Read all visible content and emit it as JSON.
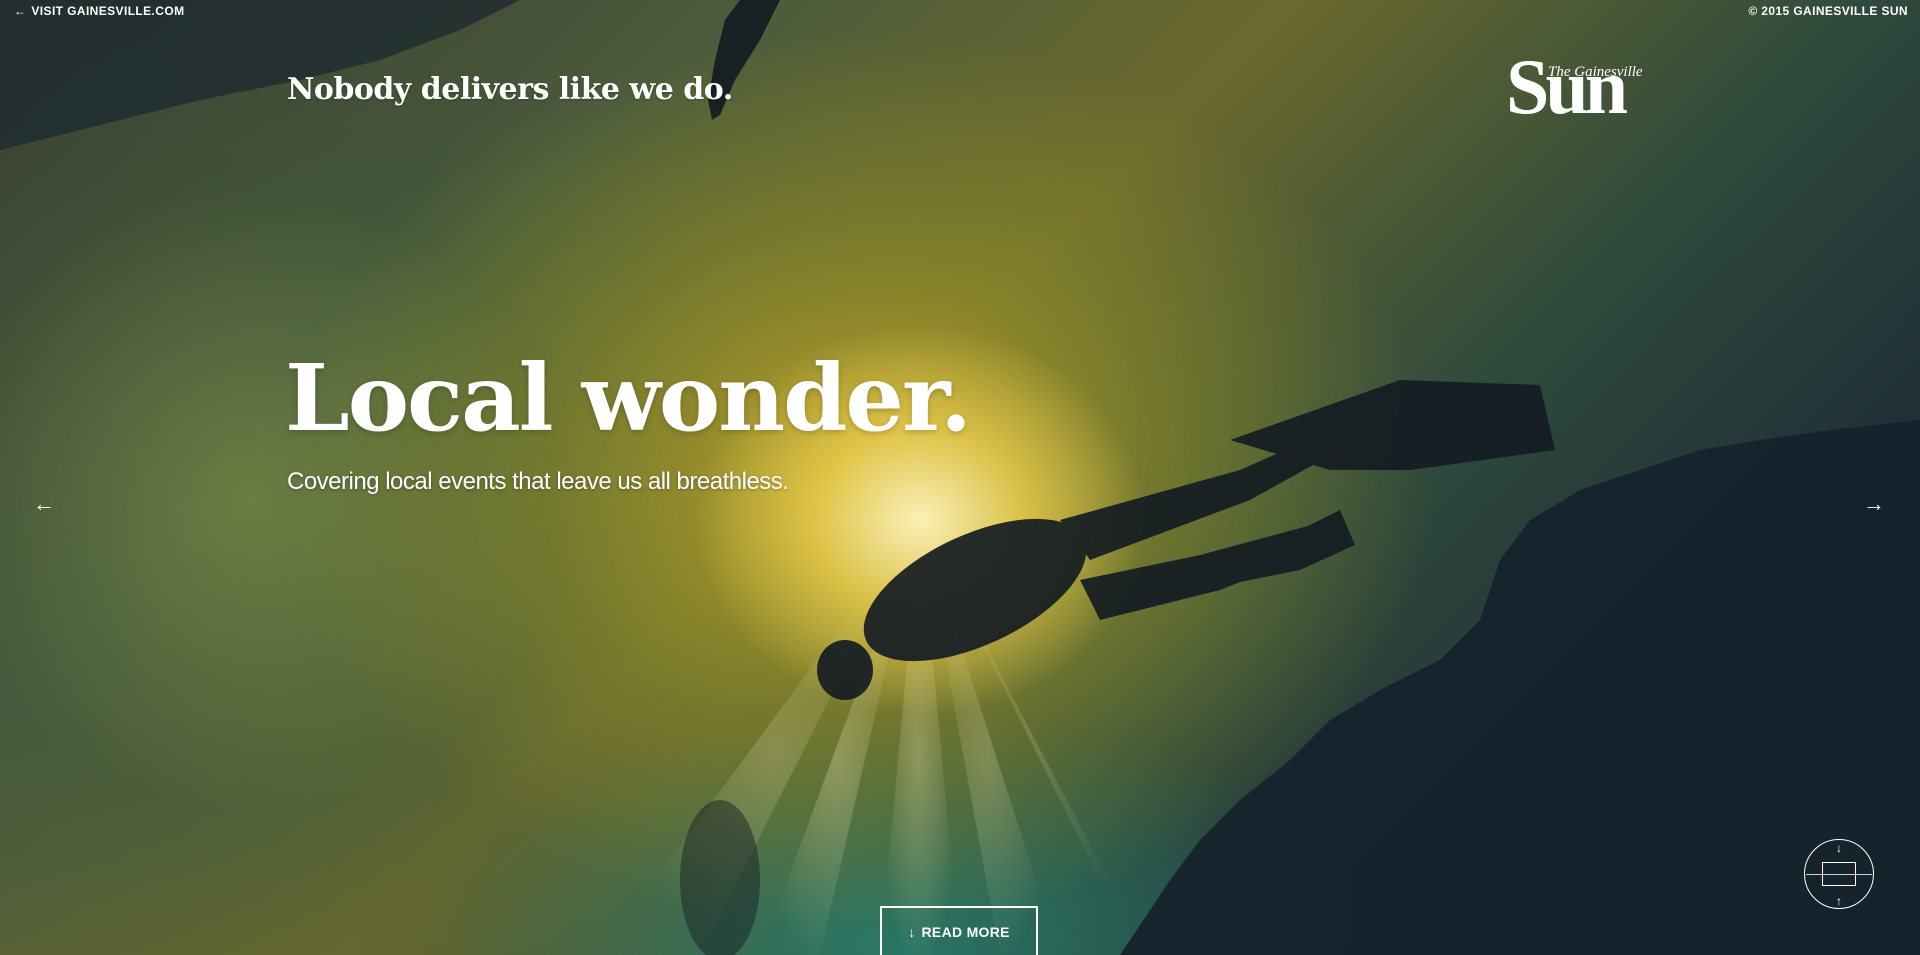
{
  "header": {
    "visit_link": "VISIT GAINESVILLE.COM",
    "copyright": "© 2015 GAINESVILLE SUN",
    "slogan": "Nobody delivers like we do."
  },
  "logo": {
    "small_text": "The Gainesville",
    "big_text": "Sun"
  },
  "hero": {
    "headline": "Local wonder.",
    "subheadline": "Covering local events that leave us all breathless."
  },
  "carousel": {
    "prev_icon": "arrow-left-icon",
    "next_icon": "arrow-right-icon",
    "prev_glyph": "←",
    "next_glyph": "→"
  },
  "actions": {
    "read_more_label": "READ MORE",
    "read_more_glyph": "↓"
  },
  "scroll_widget": {
    "icon": "scroll-navigation-icon",
    "up_glyph": "↓",
    "down_glyph": "↑"
  },
  "colors": {
    "text": "#ffffff",
    "background_dark": "#1b2a35",
    "glow": "#f0d250"
  }
}
